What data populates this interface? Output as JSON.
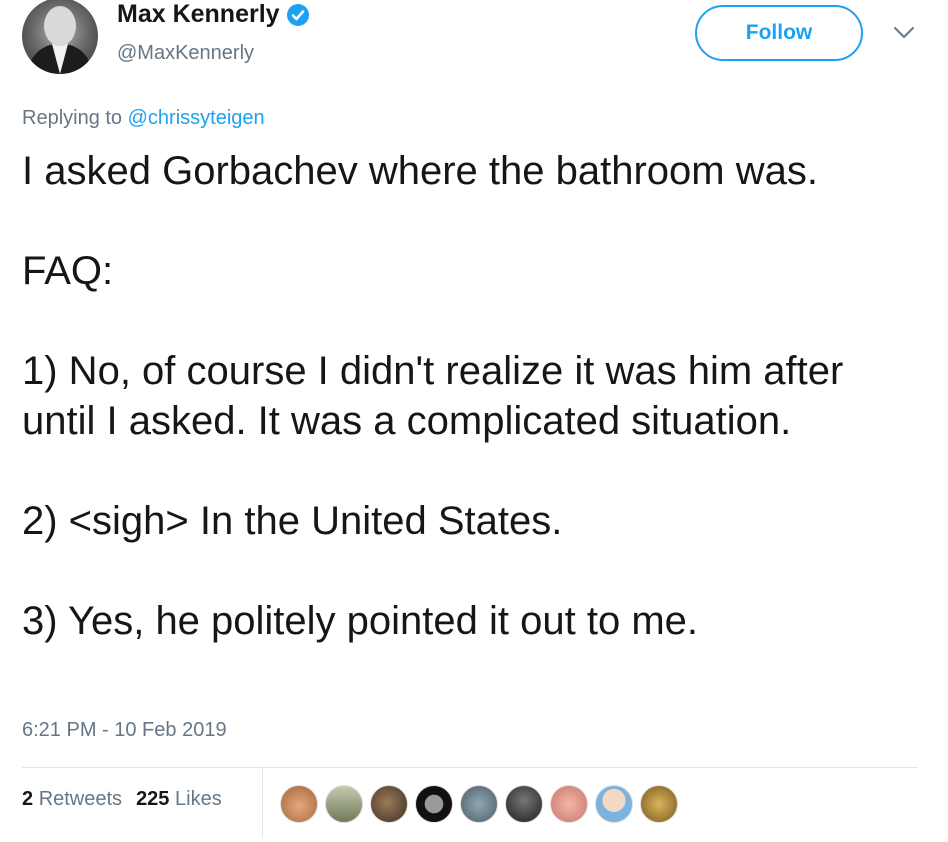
{
  "author": {
    "display_name": "Max Kennerly",
    "handle": "@MaxKennerly",
    "verified": true
  },
  "follow_button": {
    "label": "Follow"
  },
  "reply_context": {
    "prefix": "Replying to",
    "mention": "@chrissyteigen"
  },
  "tweet": {
    "line1": "I asked Gorbachev where the bathroom was.",
    "line2": "FAQ:",
    "line3": "1) No, of course I didn't realize it was him after until I asked. It was a complicated situation.",
    "line4": "2) <sigh> In the United States.",
    "line5": "3) Yes, he politely pointed it out to me."
  },
  "timestamp": "6:21 PM - 10 Feb 2019",
  "stats": {
    "retweets_count": "2",
    "retweets_label": "Retweets",
    "likes_count": "225",
    "likes_label": "Likes"
  },
  "colors": {
    "accent": "#1da1f2",
    "text_primary": "#14171a",
    "text_secondary": "#657786",
    "divider": "#e1e8ed"
  },
  "icons": {
    "verified": "verified-badge-icon",
    "caret": "chevron-down-icon"
  }
}
